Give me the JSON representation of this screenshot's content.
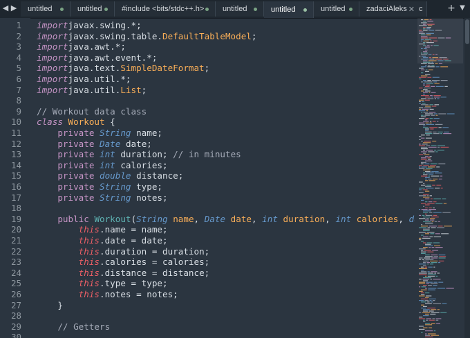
{
  "tabs": [
    {
      "label": "untitled"
    },
    {
      "label": "untitled"
    },
    {
      "label": "#include <bits/stdc++.h>"
    },
    {
      "label": "untitled"
    },
    {
      "label": "untitled"
    },
    {
      "label": "untitled"
    },
    {
      "label": "zadaciAleks"
    },
    {
      "label": "c"
    }
  ],
  "editor": {
    "lines": [
      {
        "n": "1",
        "seg": [
          [
            "kw",
            "import"
          ],
          [
            "",
            "javax.swing.*;"
          ]
        ]
      },
      {
        "n": "2",
        "seg": [
          [
            "kw",
            "import"
          ],
          [
            "",
            "javax.swing.table."
          ],
          [
            "cls",
            "DefaultTableModel"
          ],
          [
            "",
            ";"
          ]
        ]
      },
      {
        "n": "3",
        "seg": [
          [
            "kw",
            "import"
          ],
          [
            "",
            "java.awt.*;"
          ]
        ]
      },
      {
        "n": "4",
        "seg": [
          [
            "kw",
            "import"
          ],
          [
            "",
            "java.awt.event.*;"
          ]
        ]
      },
      {
        "n": "5",
        "seg": [
          [
            "kw",
            "import"
          ],
          [
            "",
            "java.text."
          ],
          [
            "cls",
            "SimpleDateFormat"
          ],
          [
            "",
            ";"
          ]
        ]
      },
      {
        "n": "6",
        "seg": [
          [
            "kw",
            "import"
          ],
          [
            "",
            "java.util.*;"
          ]
        ]
      },
      {
        "n": "7",
        "seg": [
          [
            "kw",
            "import"
          ],
          [
            "",
            "java.util."
          ],
          [
            "cls",
            "List"
          ],
          [
            "",
            ";"
          ]
        ]
      },
      {
        "n": "8",
        "seg": []
      },
      {
        "n": "9",
        "seg": [
          [
            "cm",
            "// Workout data class"
          ]
        ]
      },
      {
        "n": "10",
        "seg": [
          [
            "kw",
            "class"
          ],
          [
            "",
            " "
          ],
          [
            "cls",
            "Workout"
          ],
          [
            "",
            " {"
          ]
        ]
      },
      {
        "n": "11",
        "seg": [
          [
            "",
            "    "
          ],
          [
            "pv",
            "private"
          ],
          [
            "",
            " "
          ],
          [
            "ty",
            "String"
          ],
          [
            "",
            " name;"
          ]
        ]
      },
      {
        "n": "12",
        "seg": [
          [
            "",
            "    "
          ],
          [
            "pv",
            "private"
          ],
          [
            "",
            " "
          ],
          [
            "ty",
            "Date"
          ],
          [
            "",
            " date;"
          ]
        ]
      },
      {
        "n": "13",
        "seg": [
          [
            "",
            "    "
          ],
          [
            "pv",
            "private"
          ],
          [
            "",
            " "
          ],
          [
            "ty",
            "int"
          ],
          [
            "",
            " duration; "
          ],
          [
            "cm",
            "// in minutes"
          ]
        ]
      },
      {
        "n": "14",
        "seg": [
          [
            "",
            "    "
          ],
          [
            "pv",
            "private"
          ],
          [
            "",
            " "
          ],
          [
            "ty",
            "int"
          ],
          [
            "",
            " calories;"
          ]
        ]
      },
      {
        "n": "15",
        "seg": [
          [
            "",
            "    "
          ],
          [
            "pv",
            "private"
          ],
          [
            "",
            " "
          ],
          [
            "ty",
            "double"
          ],
          [
            "",
            " distance;"
          ]
        ]
      },
      {
        "n": "16",
        "seg": [
          [
            "",
            "    "
          ],
          [
            "pv",
            "private"
          ],
          [
            "",
            " "
          ],
          [
            "ty",
            "String"
          ],
          [
            "",
            " type;"
          ]
        ]
      },
      {
        "n": "17",
        "seg": [
          [
            "",
            "    "
          ],
          [
            "pv",
            "private"
          ],
          [
            "",
            " "
          ],
          [
            "ty",
            "String"
          ],
          [
            "",
            " notes;"
          ]
        ]
      },
      {
        "n": "18",
        "seg": []
      },
      {
        "n": "19",
        "seg": [
          [
            "",
            "    "
          ],
          [
            "pv",
            "public"
          ],
          [
            "",
            " "
          ],
          [
            "fn",
            "Workout"
          ],
          [
            "",
            "("
          ],
          [
            "ty",
            "String"
          ],
          [
            "",
            " "
          ],
          [
            "pm",
            "name"
          ],
          [
            "",
            ", "
          ],
          [
            "ty",
            "Date"
          ],
          [
            "",
            " "
          ],
          [
            "pm",
            "date"
          ],
          [
            "",
            ", "
          ],
          [
            "ty",
            "int"
          ],
          [
            "",
            " "
          ],
          [
            "pm",
            "duration"
          ],
          [
            "",
            ", "
          ],
          [
            "ty",
            "int"
          ],
          [
            "",
            " "
          ],
          [
            "pm",
            "calories"
          ],
          [
            "",
            ", "
          ],
          [
            "ty",
            "double"
          ]
        ]
      },
      {
        "n": "20",
        "seg": [
          [
            "",
            "        "
          ],
          [
            "th",
            "this"
          ],
          [
            "",
            ".name = name;"
          ]
        ]
      },
      {
        "n": "21",
        "seg": [
          [
            "",
            "        "
          ],
          [
            "th",
            "this"
          ],
          [
            "",
            ".date = date;"
          ]
        ]
      },
      {
        "n": "22",
        "seg": [
          [
            "",
            "        "
          ],
          [
            "th",
            "this"
          ],
          [
            "",
            ".duration = duration;"
          ]
        ]
      },
      {
        "n": "23",
        "seg": [
          [
            "",
            "        "
          ],
          [
            "th",
            "this"
          ],
          [
            "",
            ".calories = calories;"
          ]
        ]
      },
      {
        "n": "24",
        "seg": [
          [
            "",
            "        "
          ],
          [
            "th",
            "this"
          ],
          [
            "",
            ".distance = distance;"
          ]
        ]
      },
      {
        "n": "25",
        "seg": [
          [
            "",
            "        "
          ],
          [
            "th",
            "this"
          ],
          [
            "",
            ".type = type;"
          ]
        ]
      },
      {
        "n": "26",
        "seg": [
          [
            "",
            "        "
          ],
          [
            "th",
            "this"
          ],
          [
            "",
            ".notes = notes;"
          ]
        ]
      },
      {
        "n": "27",
        "seg": [
          [
            "",
            "    }"
          ]
        ]
      },
      {
        "n": "28",
        "seg": []
      },
      {
        "n": "29",
        "seg": [
          [
            "",
            "    "
          ],
          [
            "cm",
            "// Getters"
          ]
        ]
      },
      {
        "n": "30",
        "seg": []
      }
    ]
  },
  "icons": {
    "back": "chevron-left-icon",
    "forward": "chevron-right-icon",
    "new_tab": "plus-icon",
    "tab_menu": "chevron-down-icon",
    "modified": "dot-icon",
    "close": "close-icon"
  },
  "colors": {
    "background": "#2b3540",
    "tabbar": "#1e262e",
    "keyword": "#c594c5",
    "type": "#6699cc",
    "class": "#f9ae58",
    "function": "#5fb4b4",
    "comment": "#a6acb9",
    "this": "#ec5f66"
  }
}
